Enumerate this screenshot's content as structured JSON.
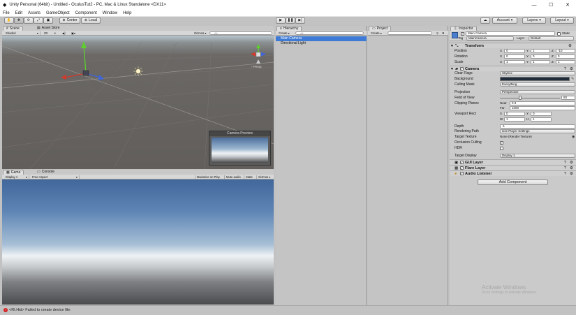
{
  "window": {
    "title": "Unity Personal (64bit) - Untitled - OculusTut2 - PC, Mac & Linux Standalone <DX11>",
    "controls": [
      "—",
      "☐",
      "✕"
    ]
  },
  "menu": [
    "File",
    "Edit",
    "Assets",
    "GameObject",
    "Component",
    "Window",
    "Help"
  ],
  "toolbar": {
    "center_label": "Center",
    "local_label": "Local",
    "account_label": "Account",
    "layers_label": "Layers",
    "layout_label": "Layout"
  },
  "scene": {
    "tabs": [
      {
        "label": "Scene"
      },
      {
        "label": "Asset Store"
      }
    ],
    "shading": "Shaded",
    "mode_2d": "2D",
    "gizmos": "Gizmos",
    "search_placeholder": "All",
    "persp_label": "‹ Persp",
    "camera_preview_title": "Camera Preview"
  },
  "game": {
    "tabs": [
      {
        "label": "Game"
      },
      {
        "label": "Console"
      }
    ],
    "display": "Display 1",
    "aspect": "Free Aspect",
    "options": [
      "Maximize on Play",
      "Mute audio",
      "Stats",
      "Gizmos"
    ]
  },
  "hierarchy": {
    "tab": "Hierarchy",
    "create": "Create",
    "search_placeholder": "All",
    "items": [
      {
        "label": "Main Camera"
      },
      {
        "label": "Directional Light"
      }
    ]
  },
  "project": {
    "tab": "Project",
    "create": "Create"
  },
  "inspector": {
    "tab": "Inspector",
    "object_name": "Main Camera",
    "static_label": "Static",
    "tag_label": "Tag",
    "tag_value": "MainCamera",
    "layer_label": "Layer",
    "layer_value": "Default",
    "transform": {
      "title": "Transform",
      "rows": [
        {
          "label": "Position",
          "x": "0",
          "y": "1",
          "z": "-10"
        },
        {
          "label": "Rotation",
          "x": "0",
          "y": "0",
          "z": "0"
        },
        {
          "label": "Scale",
          "x": "1",
          "y": "1",
          "z": "1"
        }
      ]
    },
    "camera": {
      "title": "Camera",
      "clear_flags_label": "Clear Flags",
      "clear_flags": "Skybox",
      "background_label": "Background",
      "culling_mask_label": "Culling Mask",
      "culling_mask": "Everything",
      "projection_label": "Projection",
      "projection": "Perspective",
      "fov_label": "Field of View",
      "fov": "60",
      "clipping_label": "Clipping Planes",
      "near_label": "Near",
      "near": "0.3",
      "far_label": "Far",
      "far": "1000",
      "viewport_label": "Viewport Rect",
      "vx": "0",
      "vy": "0",
      "vw": "1",
      "vh": "1",
      "depth_label": "Depth",
      "depth": "-1",
      "rendering_path_label": "Rendering Path",
      "rendering_path": "Use Player Settings",
      "target_texture_label": "Target Texture",
      "target_texture": "None (Render Texture)",
      "occlusion_label": "Occlusion Culling",
      "hdr_label": "HDR",
      "target_display_label": "Target Display",
      "target_display": "Display 1"
    },
    "components": [
      {
        "label": "GUI Layer"
      },
      {
        "label": "Flare Layer"
      },
      {
        "label": "Audio Listener"
      }
    ],
    "add_component": "Add Component"
  },
  "status": {
    "message": "<RI.Hid> Failed to create device file:"
  },
  "watermark": {
    "line1": "Activate Windows",
    "line2": "Go to Settings to activate Windows."
  },
  "colors": {
    "selection": "#3d7bd6",
    "camera_background": "#1f2a3a",
    "error": "#d42020"
  }
}
